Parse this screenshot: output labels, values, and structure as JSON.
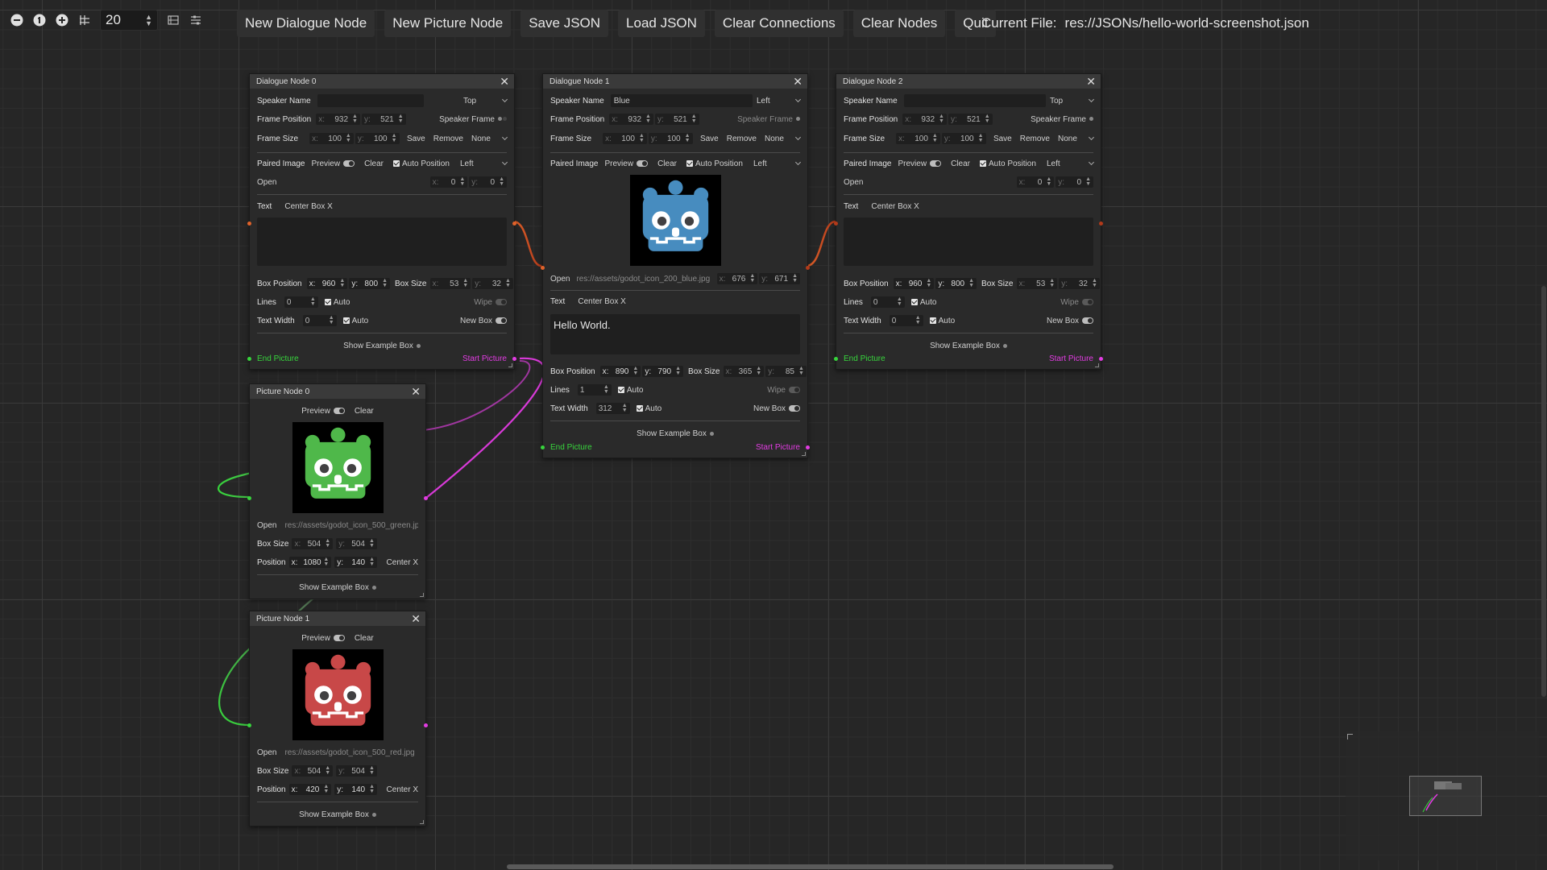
{
  "toolbar": {
    "snap_value": "20",
    "buttons": [
      "New Dialogue Node",
      "New Picture Node",
      "Save JSON",
      "Load JSON",
      "Clear Connections",
      "Clear Nodes",
      "Quit"
    ],
    "current_file_label": "Current File:",
    "current_file": "res://JSONs/hello-world-screenshot.json"
  },
  "labels": {
    "speaker_name": "Speaker Name",
    "frame_position": "Frame Position",
    "frame_size": "Frame Size",
    "speaker_frame": "Speaker Frame",
    "save": "Save",
    "remove": "Remove",
    "paired_image": "Paired Image",
    "preview": "Preview",
    "clear": "Clear",
    "auto_position": "Auto Position",
    "open": "Open",
    "text": "Text",
    "center_box_x": "Center Box X",
    "box_position": "Box Position",
    "box_size": "Box Size",
    "lines": "Lines",
    "auto": "Auto",
    "wipe": "Wipe",
    "text_width": "Text Width",
    "new_box": "New Box",
    "show_example_box": "Show Example Box",
    "end_picture": "End Picture",
    "start_picture": "Start Picture",
    "position": "Position",
    "center_x": "Center X",
    "x": "x:",
    "y": "y:"
  },
  "dialogue_nodes": [
    {
      "title": "Dialogue Node 0",
      "speaker_name": "",
      "speaker_side": "Top",
      "frame_x": "932",
      "frame_y": "521",
      "frame_w": "100",
      "frame_h": "100",
      "frame_dropdown": "None",
      "image_align": "Left",
      "image_path": "",
      "image_x": "0",
      "image_y": "0",
      "text": "",
      "box_x": "960",
      "box_y": "800",
      "box_w": "53",
      "box_h": "32",
      "lines": "0",
      "text_width": "0"
    },
    {
      "title": "Dialogue Node 1",
      "speaker_name": "Blue",
      "speaker_side": "Left",
      "frame_x": "932",
      "frame_y": "521",
      "frame_w": "100",
      "frame_h": "100",
      "frame_dropdown": "None",
      "image_align": "Left",
      "image_path": "res://assets/godot_icon_200_blue.jpg",
      "image_x": "676",
      "image_y": "671",
      "text": "Hello World.",
      "box_x": "890",
      "box_y": "790",
      "box_w": "365",
      "box_h": "85",
      "lines": "1",
      "text_width": "312"
    },
    {
      "title": "Dialogue Node 2",
      "speaker_name": "",
      "speaker_side": "Top",
      "frame_x": "932",
      "frame_y": "521",
      "frame_w": "100",
      "frame_h": "100",
      "frame_dropdown": "None",
      "image_align": "Left",
      "image_path": "",
      "image_x": "0",
      "image_y": "0",
      "text": "",
      "box_x": "960",
      "box_y": "800",
      "box_w": "53",
      "box_h": "32",
      "lines": "0",
      "text_width": "0"
    }
  ],
  "picture_nodes": [
    {
      "title": "Picture Node 0",
      "image_path": "res://assets/godot_icon_500_green.jp",
      "box_w": "504",
      "box_h": "504",
      "pos_x": "1080",
      "pos_y": "140",
      "icon_color": "#4fb84a"
    },
    {
      "title": "Picture Node 1",
      "image_path": "res://assets/godot_icon_500_red.jpg",
      "box_w": "504",
      "box_h": "504",
      "pos_x": "420",
      "pos_y": "140",
      "icon_color": "#c84848"
    }
  ],
  "colors": {
    "blue_icon": "#478cbf",
    "green_port": "#37d43c",
    "magenta_port": "#e23ce2",
    "orange_port": "#e0622a"
  }
}
